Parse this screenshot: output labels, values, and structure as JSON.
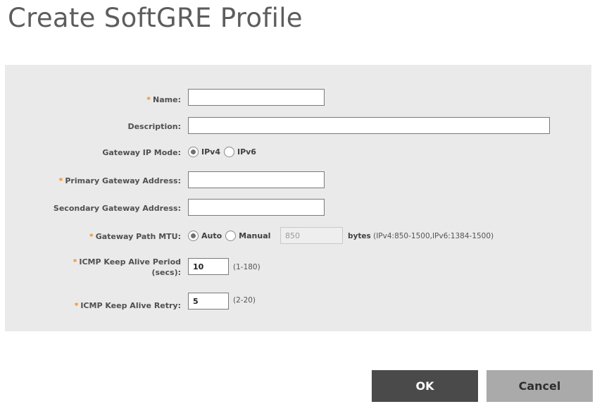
{
  "page": {
    "title": "Create SoftGRE Profile"
  },
  "colors": {
    "required_marker": "#f28c28",
    "panel_background": "#eaeaea",
    "ok_button": "#4a4a4a",
    "cancel_button": "#aaaaaa"
  },
  "form": {
    "required_marker": "*",
    "name": {
      "label": "Name:",
      "value": ""
    },
    "description": {
      "label": "Description:",
      "value": ""
    },
    "gateway_ip_mode": {
      "label": "Gateway IP Mode:",
      "options": [
        "IPv4",
        "IPv6"
      ],
      "selected": "IPv4"
    },
    "primary_gateway": {
      "label": "Primary Gateway Address:",
      "value": ""
    },
    "secondary_gateway": {
      "label": "Secondary Gateway Address:",
      "value": ""
    },
    "gateway_path_mtu": {
      "label": "Gateway Path MTU:",
      "options": [
        "Auto",
        "Manual"
      ],
      "selected": "Auto",
      "manual_value": "850",
      "unit": "bytes",
      "range_hint": "(IPv4:850-1500,IPv6:1384-1500)"
    },
    "icmp_keep_alive_period": {
      "label_line1": "ICMP Keep Alive Period",
      "label_line2": "(secs):",
      "value": "10",
      "range_hint": "(1-180)"
    },
    "icmp_keep_alive_retry": {
      "label": "ICMP Keep Alive Retry:",
      "value": "5",
      "range_hint": "(2-20)"
    }
  },
  "actions": {
    "ok_label": "OK",
    "cancel_label": "Cancel"
  }
}
